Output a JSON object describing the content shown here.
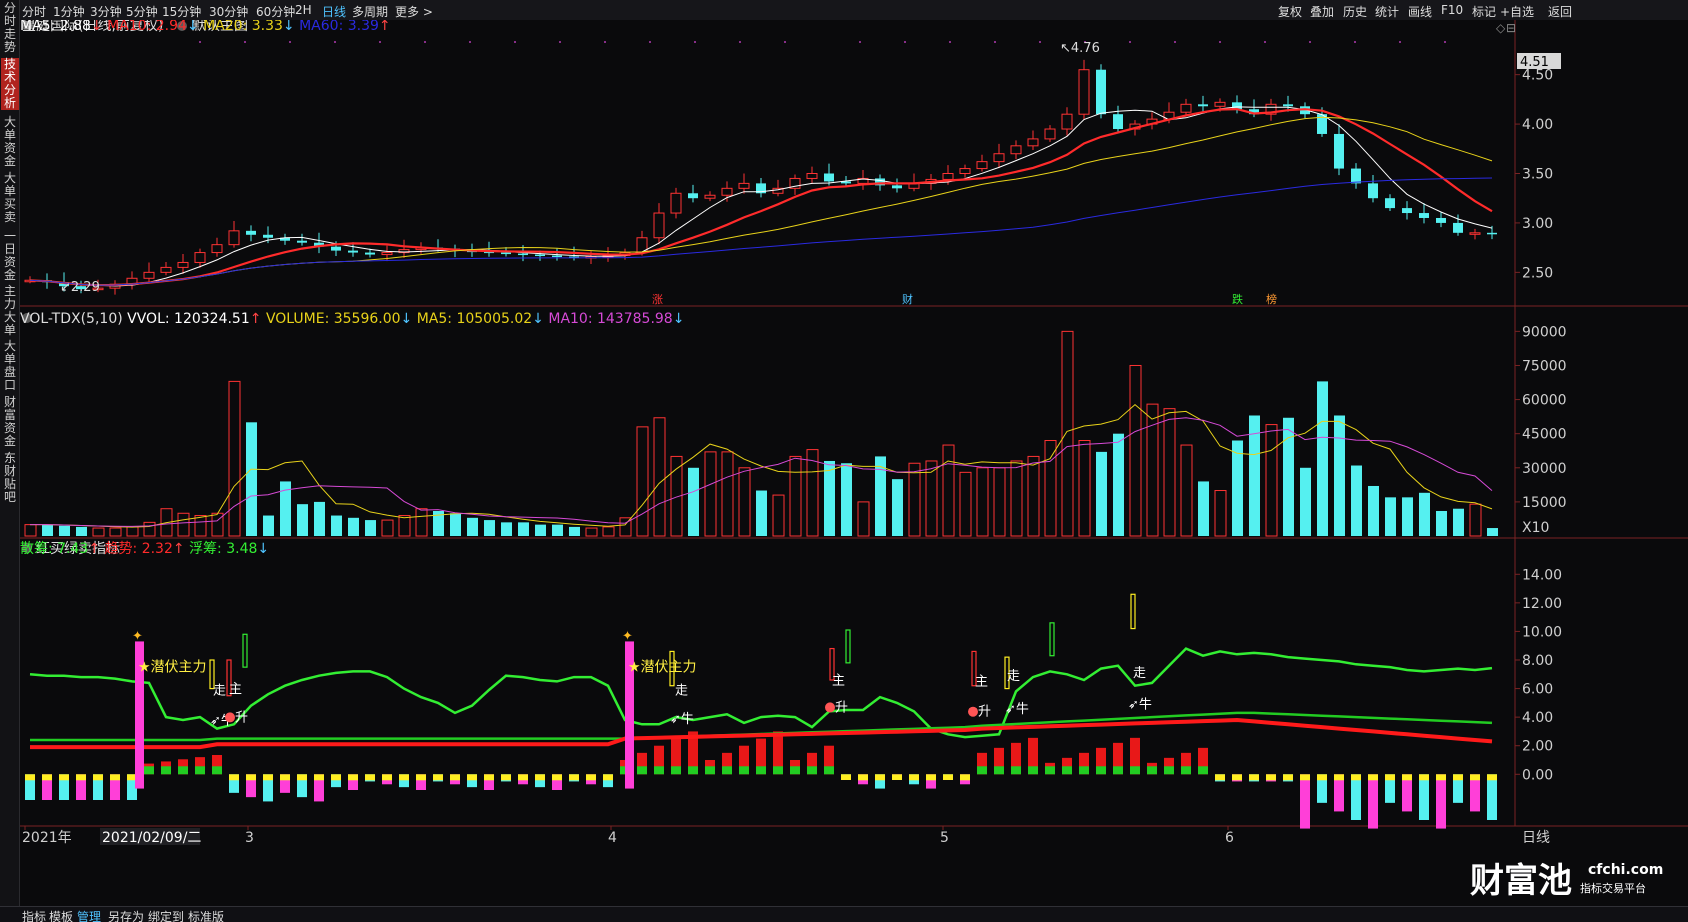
{
  "topbar": {
    "periods": [
      "分时",
      "1分钟",
      "3分钟",
      "5分钟",
      "15分钟",
      "30分钟",
      "60分钟",
      "2H",
      "日线",
      "多周期",
      "更多 >"
    ],
    "active_period": "日线",
    "tools": [
      "复权",
      "叠加",
      "历史",
      "统计",
      "画线",
      "F10",
      "标记",
      "+自选",
      "返回"
    ]
  },
  "sidebar": {
    "tabs": [
      "分时走势",
      "技术分析",
      "大单资金",
      "大单买卖",
      "一日资金",
      "主力大单",
      "大单盘口",
      "财富资金",
      "东财贴吧"
    ],
    "active": "技术分析"
  },
  "main_panel": {
    "title": "皇庭国际(日线,前复权)",
    "template": "默认主图",
    "ma": [
      {
        "label": "MA5: 2.88",
        "arrow": "↓",
        "color": "#ffffff"
      },
      {
        "label": "MA10: 2.94",
        "arrow": "↓",
        "color": "#ff2b2b"
      },
      {
        "label": "MA20: 3.33",
        "arrow": "↓",
        "color": "#e8d21a"
      },
      {
        "label": "MA60: 3.39",
        "arrow": "↑",
        "color": "#2a2ae0"
      }
    ],
    "y_ticks": [
      "4.50",
      "4.00",
      "3.50",
      "3.00",
      "2.50"
    ],
    "current_price": "4.51",
    "high_label": "4.76",
    "low_label": "2.29",
    "event_markers": [
      {
        "text": "涨",
        "color": "#ff3333"
      },
      {
        "text": "财",
        "color": "#4fc3ff"
      },
      {
        "text": "跌",
        "color": "#33ee33"
      },
      {
        "text": "榜",
        "color": "#ff9933"
      }
    ]
  },
  "volume_panel": {
    "indicator": "VOL-TDX(5,10)",
    "values": [
      {
        "label": "VVOL: 120324.51",
        "arrow": "↑",
        "color": "#ffffff"
      },
      {
        "label": "VOLUME: 35596.00",
        "arrow": "↓",
        "color": "#e8d21a"
      },
      {
        "label": "MA5: 105005.02",
        "arrow": "↓",
        "color": "#e8d21a"
      },
      {
        "label": "MA10: 143785.98",
        "arrow": "↓",
        "color": "#d64ad6"
      }
    ],
    "y_ticks": [
      "90000",
      "75000",
      "60000",
      "45000",
      "30000",
      "15000"
    ],
    "unit": "X10"
  },
  "indicator_panel": {
    "title": "红买绿卖指标",
    "values": [
      {
        "label": "散筹: 7.43",
        "arrow": "↑",
        "color": "#33ee33"
      },
      {
        "label": "趋势: 2.32",
        "arrow": "↑",
        "color": "#ff2b2b"
      },
      {
        "label": "浮筹: 3.48",
        "arrow": "↓",
        "color": "#33ee33"
      }
    ],
    "y_ticks": [
      "14.00",
      "12.00",
      "10.00",
      "8.00",
      "6.00",
      "4.00",
      "2.00",
      "0.00"
    ],
    "signal_text": "★潜伏主力",
    "walk_text": "走",
    "main_text": "主",
    "bull_text": "牛",
    "up_text": "升"
  },
  "x_axis": {
    "labels": [
      "2021年",
      "3",
      "4",
      "5",
      "6"
    ],
    "cursor_date": "2021/02/09/二",
    "right_label": "日线"
  },
  "bottombar": {
    "items": [
      "指标",
      "模板",
      "管理",
      "另存为",
      "绑定到",
      "标准版"
    ],
    "active": "管理"
  },
  "watermark": {
    "brand": "财富池",
    "domain": "cfchi.com",
    "slogan": "指标交易平台"
  },
  "colors": {
    "up": "#ff3333",
    "down": "#55f0f0",
    "ma5": "#ffffff",
    "ma10": "#ff2b2b",
    "ma20": "#e8d21a",
    "ma60": "#2a2ae0",
    "sancou": "#33ee33",
    "trend": "#ff1a1a",
    "magenta": "#ff3fd8",
    "yellow": "#ffee22"
  }
}
